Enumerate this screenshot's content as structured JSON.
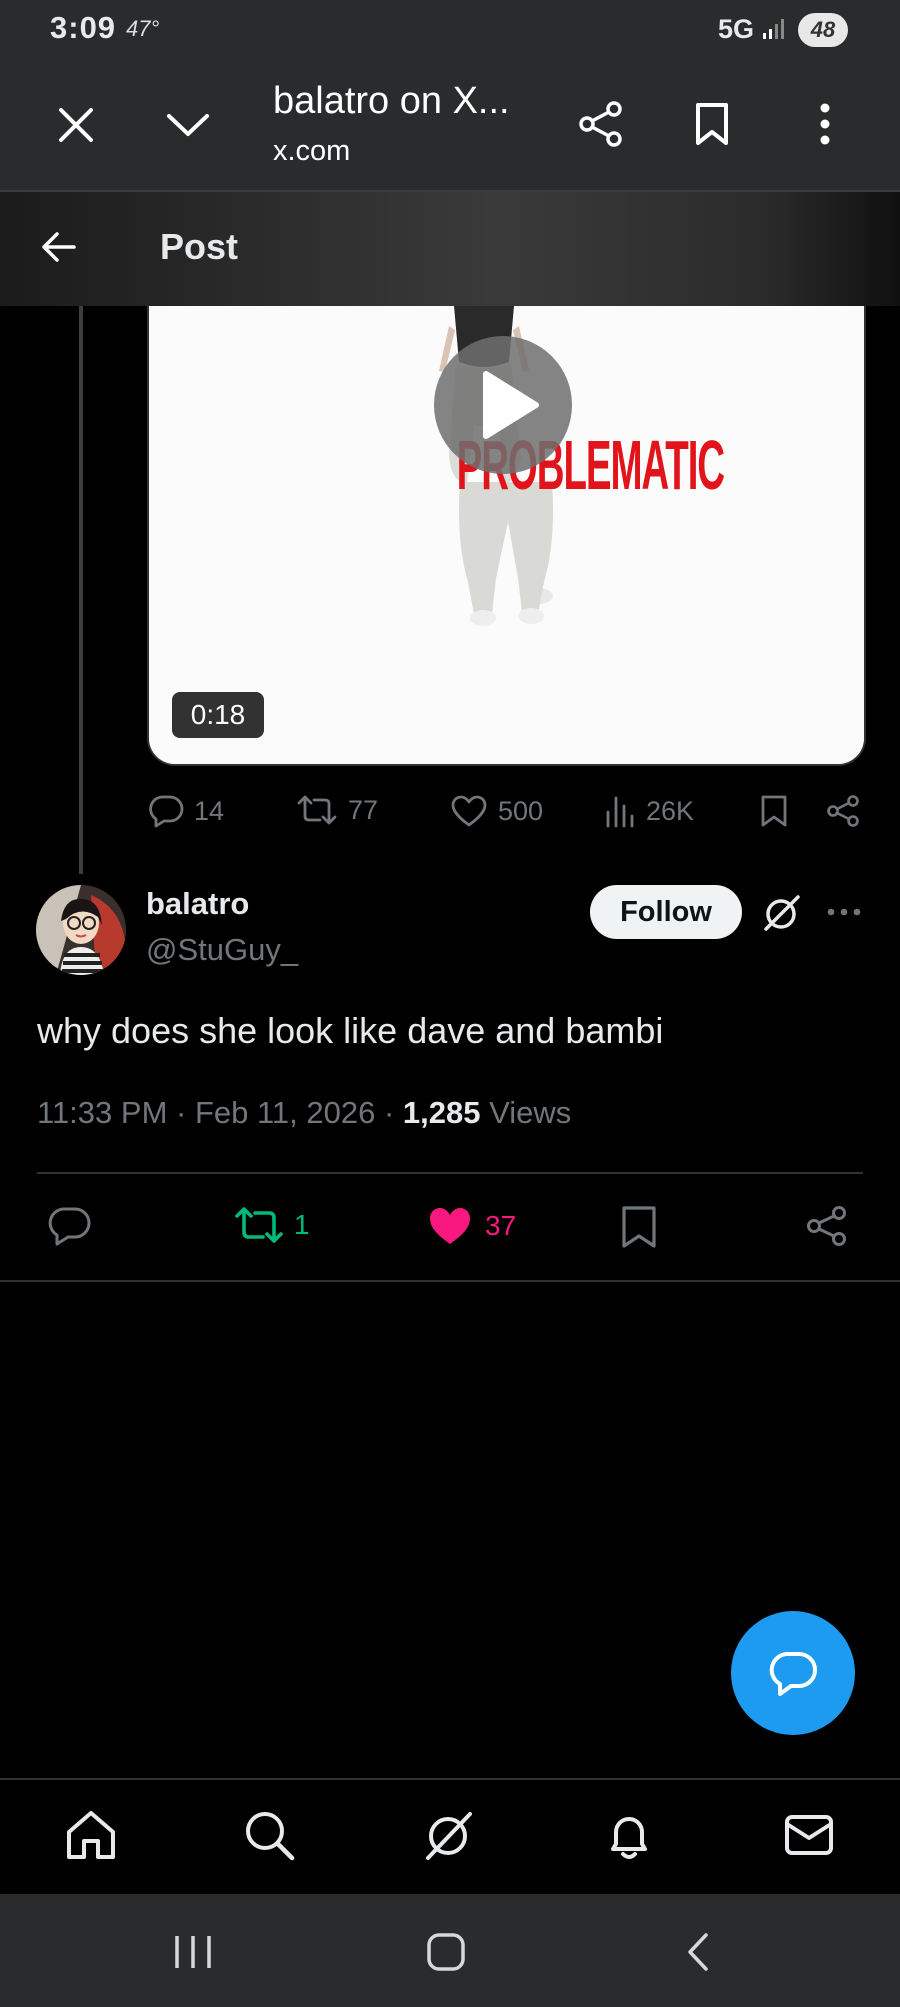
{
  "status_bar": {
    "time": "3:09",
    "temperature": "47°",
    "network": "5G",
    "battery": "48"
  },
  "browser": {
    "title": "balatro on X...",
    "url": "x.com",
    "icons": [
      "close-icon",
      "chevron-down-icon",
      "share-icon",
      "bookmark-icon",
      "more-vertical-icon"
    ]
  },
  "post_header": {
    "title": "Post"
  },
  "parent_post": {
    "video": {
      "caption": "PROBLEMATIC",
      "duration": "0:18"
    },
    "actions": {
      "replies": "14",
      "reposts": "77",
      "likes": "500",
      "views": "26K"
    }
  },
  "tweet": {
    "author_name": "balatro",
    "author_handle": "@StuGuy_",
    "follow_label": "Follow",
    "text": "why does she look like dave and bambi",
    "time": "11:33 PM",
    "date": "Feb 11, 2026",
    "views_count": "1,285",
    "views_label": "Views",
    "reposts": "1",
    "likes": "37"
  },
  "colors": {
    "accent": "#1d9bf0",
    "repost_active": "#00ba7c",
    "like_active": "#f91880",
    "muted": "#71767b"
  },
  "bottom_nav": [
    "home-icon",
    "search-icon",
    "grok-icon",
    "notifications-icon",
    "messages-icon"
  ]
}
